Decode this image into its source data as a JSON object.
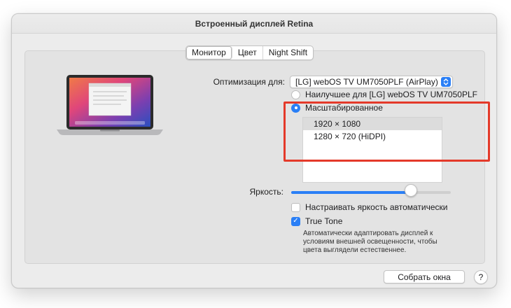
{
  "window": {
    "title": "Встроенный дисплей Retina"
  },
  "tabs": [
    {
      "label": "Монитор",
      "active": true
    },
    {
      "label": "Цвет",
      "active": false
    },
    {
      "label": "Night Shift",
      "active": false
    }
  ],
  "optimization": {
    "label": "Оптимизация для:",
    "value": "[LG] webOS TV UM7050PLF (AirPlay)"
  },
  "resolution_mode": {
    "options": [
      {
        "label": "Наилучшее для [LG] webOS TV UM7050PLF",
        "checked": false
      },
      {
        "label": "Масштабированное",
        "checked": true
      }
    ]
  },
  "resolutions": [
    {
      "label": "1920 × 1080",
      "selected": true
    },
    {
      "label": "1280 × 720 (HiDPI)",
      "selected": false
    }
  ],
  "brightness": {
    "label": "Яркость:",
    "level": 0.75
  },
  "auto_brightness": {
    "label": "Настраивать яркость автоматически",
    "checked": false
  },
  "true_tone": {
    "label": "True Tone",
    "checked": true,
    "description": "Автоматически адаптировать дисплей к условиям внешней освещенности, чтобы цвета выглядели естественнее."
  },
  "footer": {
    "gather_windows_label": "Собрать окна",
    "help_label": "?"
  },
  "colors": {
    "accent": "#2a7ff6",
    "highlight_border": "#e43a2a"
  }
}
